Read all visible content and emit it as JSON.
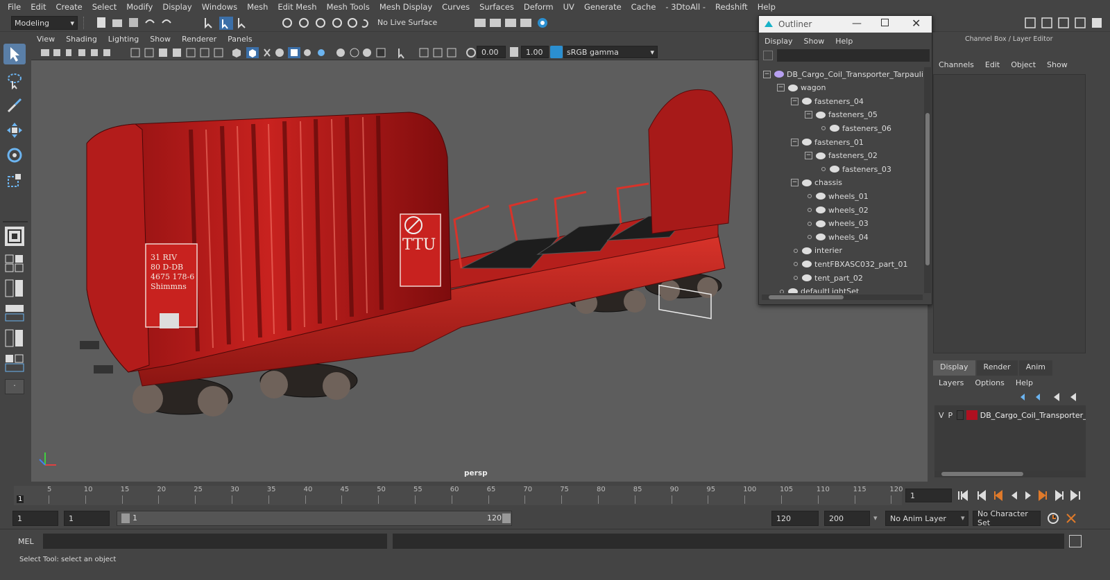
{
  "menubar": [
    "File",
    "Edit",
    "Create",
    "Select",
    "Modify",
    "Display",
    "Windows",
    "Mesh",
    "Edit Mesh",
    "Mesh Tools",
    "Mesh Display",
    "Curves",
    "Surfaces",
    "Deform",
    "UV",
    "Generate",
    "Cache",
    "- 3DtoAll -",
    "Redshift",
    "Help"
  ],
  "toolbar": {
    "mode": "Modeling",
    "live_surface": "No Live Surface"
  },
  "panel_menu": [
    "View",
    "Shading",
    "Lighting",
    "Show",
    "Renderer",
    "Panels"
  ],
  "panel_toolbar": {
    "exposure": "0.00",
    "gamma": "1.00",
    "colorspace": "sRGB gamma"
  },
  "viewport": {
    "camera_label": "persp",
    "decal_top": "TTU",
    "decal_side_line1": "31 RIV",
    "decal_side_line2": "80 D-DB",
    "decal_side_line3": "4675 178-6",
    "decal_side_line4": "Shimmns"
  },
  "outliner": {
    "title": "Outliner",
    "menu": [
      "Display",
      "Show",
      "Help"
    ],
    "items": [
      {
        "label": "DB_Cargo_Coil_Transporter_Tarpaulin",
        "icon": "transform-icon"
      },
      {
        "label": "wagon",
        "icon": "group-icon"
      },
      {
        "label": "fasteners_04",
        "icon": "group-icon"
      },
      {
        "label": "fasteners_05",
        "icon": "group-icon"
      },
      {
        "label": "fasteners_06",
        "icon": "group-icon"
      },
      {
        "label": "fasteners_01",
        "icon": "group-icon"
      },
      {
        "label": "fasteners_02",
        "icon": "group-icon"
      },
      {
        "label": "fasteners_03",
        "icon": "group-icon"
      },
      {
        "label": "chassis",
        "icon": "group-icon"
      },
      {
        "label": "wheels_01",
        "icon": "group-icon"
      },
      {
        "label": "wheels_02",
        "icon": "group-icon"
      },
      {
        "label": "wheels_03",
        "icon": "group-icon"
      },
      {
        "label": "wheels_04",
        "icon": "group-icon"
      },
      {
        "label": "interier",
        "icon": "group-icon"
      },
      {
        "label": "tentFBXASC032_part_01",
        "icon": "group-icon"
      },
      {
        "label": "tent_part_02",
        "icon": "group-icon"
      },
      {
        "label": "defaultLightSet",
        "icon": "set-icon"
      }
    ]
  },
  "channel_box": {
    "title": "Channel Box / Layer Editor",
    "menu": [
      "Channels",
      "Edit",
      "Object",
      "Show"
    ],
    "tabs": [
      "Display",
      "Render",
      "Anim"
    ],
    "layer_menu": [
      "Layers",
      "Options",
      "Help"
    ],
    "layer": {
      "v": "V",
      "p": "P",
      "name": "DB_Cargo_Coil_Transporter_Tarpaulin",
      "color": "#b01020"
    }
  },
  "timeline": {
    "ticks": [
      "5",
      "10",
      "15",
      "20",
      "25",
      "30",
      "35",
      "40",
      "45",
      "50",
      "55",
      "60",
      "65",
      "70",
      "75",
      "80",
      "85",
      "90",
      "95",
      "100",
      "105",
      "110",
      "115",
      "120"
    ],
    "start_marker": "1",
    "current_frame": "1"
  },
  "range": {
    "start": "1",
    "anim_start": "1",
    "slider_start": "1",
    "slider_end": "120",
    "end": "120",
    "anim_end": "200",
    "anim_layer": "No Anim Layer",
    "character_set": "No Character Set"
  },
  "mel": {
    "label": "MEL"
  },
  "status": {
    "text": "Select Tool: select an object"
  },
  "colors": {
    "accent": "#4a8fd8",
    "viewport_bg": "#5d5d5d",
    "wagon_red": "#c21e1e"
  }
}
